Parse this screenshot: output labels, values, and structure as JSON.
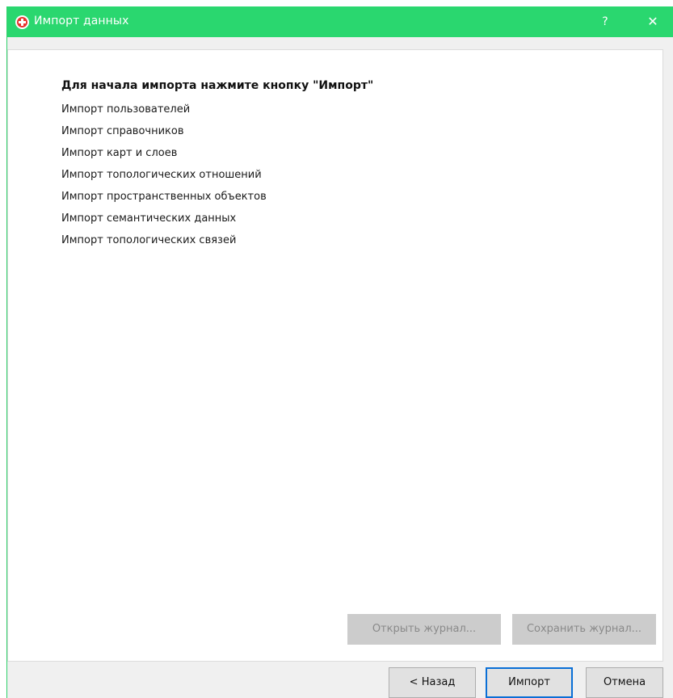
{
  "window": {
    "title": "Импорт данных",
    "help_label": "?",
    "close_label": "✕",
    "accent_color": "#2ad76f"
  },
  "main": {
    "heading": "Для начала импорта нажмите кнопку \"Импорт\"",
    "steps": [
      "Импорт пользователей",
      "Импорт справочников",
      "Импорт карт и слоев",
      "Импорт топологических отношений",
      "Импорт пространственных объектов",
      "Импорт семантических данных",
      "Импорт топологических связей"
    ],
    "open_log_label": "Открыть журнал...",
    "save_log_label": "Сохранить журнал..."
  },
  "footer": {
    "back_label": "< Назад",
    "import_label": "Импорт",
    "cancel_label": "Отмена"
  }
}
